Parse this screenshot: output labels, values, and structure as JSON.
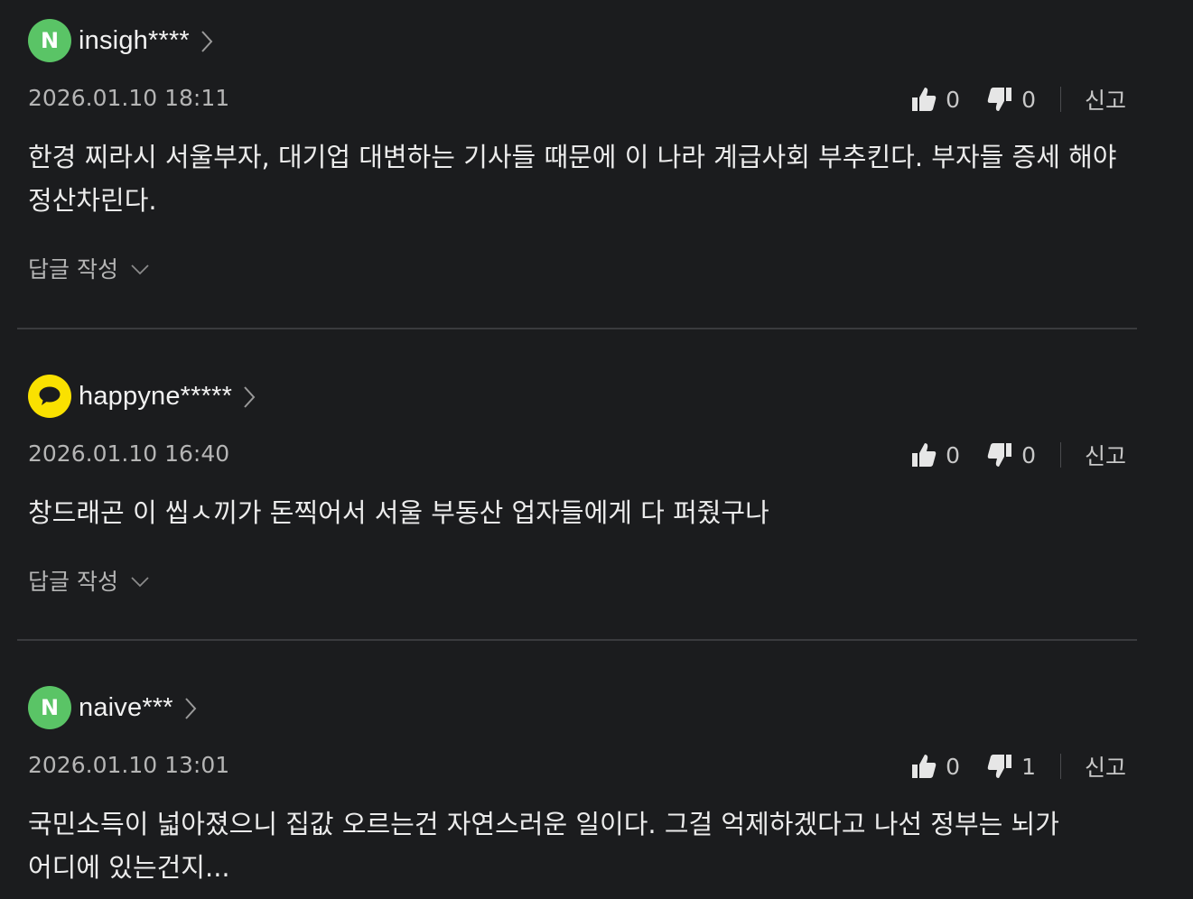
{
  "icons": {
    "like": "thumbs-up-icon",
    "dislike": "thumbs-down-icon",
    "naver_avatar": "naver-n-icon",
    "kakao_avatar": "kakao-talk-icon",
    "chevron_right": "chevron-right-icon",
    "chevron_down": "chevron-down-icon"
  },
  "colors": {
    "background": "#1b1c1e",
    "naver_green": "#5ac466",
    "kakao_yellow": "#fae100"
  },
  "comments": [
    {
      "avatar_letter": "N",
      "username": "insigh****",
      "timestamp": "2026.01.10 18:11",
      "likes": "0",
      "dislikes": "0",
      "report_label": "신고",
      "text": "한경 찌라시 서울부자, 대기업 대변하는 기사들 때문에 이 나라 계급사회 부추킨다. 부자들 증세 해야 정산차린다.",
      "reply_label": "답글 작성"
    },
    {
      "username": "happyne*****",
      "timestamp": "2026.01.10 16:40",
      "likes": "0",
      "dislikes": "0",
      "report_label": "신고",
      "text": "창드래곤 이 씹ㅅ끼가 돈찍어서 서울 부동산 업자들에게 다 퍼줬구나",
      "reply_label": "답글 작성"
    },
    {
      "avatar_letter": "N",
      "username": "naive***",
      "timestamp": "2026.01.10 13:01",
      "likes": "0",
      "dislikes": "1",
      "report_label": "신고",
      "text": "국민소득이 넓아졌으니 집값 오르는건 자연스러운 일이다. 그걸 억제하겠다고 나선 정부는 뇌가 어디에 있는건지..."
    }
  ]
}
